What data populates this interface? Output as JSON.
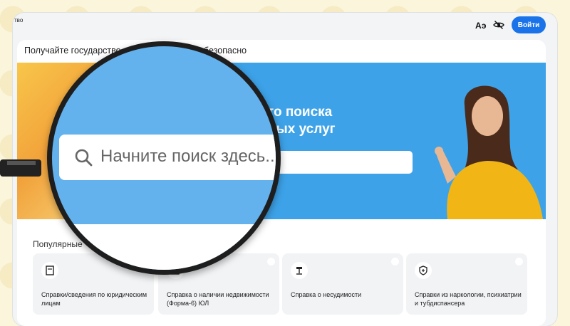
{
  "header": {
    "site_name": "тво",
    "lang_icon_text": "Аэ",
    "login_label": "Войти"
  },
  "intro_left": "Получайте государство",
  "intro_right": "безопасно",
  "banner": {
    "heading_line1": "есто поиска",
    "heading_line2": "енных услуг"
  },
  "magnifier": {
    "search_placeholder": "Начните поиск здесь..."
  },
  "popular": {
    "title": "Популярные"
  },
  "services": [
    {
      "label": "Справки/сведения по юридическим лицам"
    },
    {
      "label": "Справка о наличии недвижимости (Форма-6) ЮЛ"
    },
    {
      "label": "Справка о несудимости"
    },
    {
      "label": "Справки из наркологии, психиатрии и тубдиспансера"
    }
  ],
  "colors": {
    "accent": "#1a73e8",
    "banner": "#3da2e8",
    "magnifier_bg": "#63b2ee",
    "page_bg": "#fbf5dc"
  }
}
